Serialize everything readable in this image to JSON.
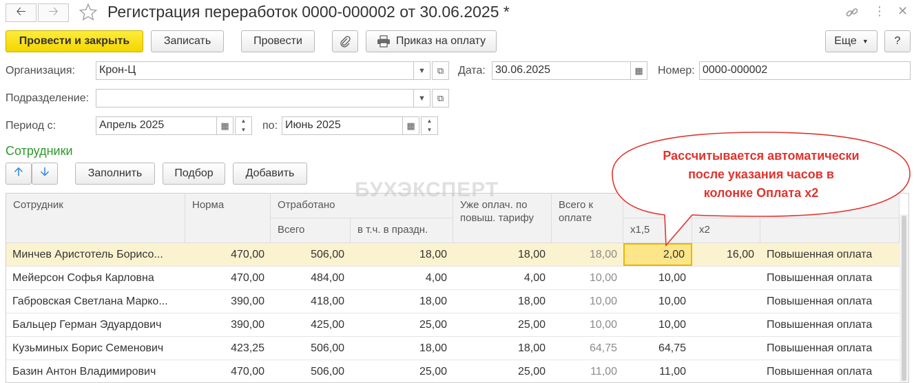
{
  "window": {
    "title": "Регистрация переработок 0000-000002 от 30.06.2025 *",
    "icons": [
      "back-arrow-icon",
      "forward-arrow-icon",
      "star-icon",
      "link-icon",
      "more-vertical-icon",
      "close-icon"
    ]
  },
  "toolbar": {
    "post_close": "Провести и закрыть",
    "save": "Записать",
    "post": "Провести",
    "print_order": "Приказ на оплату",
    "more": "Еще",
    "help": "?"
  },
  "form": {
    "org_label": "Организация:",
    "org_value": "Крон-Ц",
    "date_label": "Дата:",
    "date_value": "30.06.2025",
    "number_label": "Номер:",
    "number_value": "0000-000002",
    "dept_label": "Подразделение:",
    "dept_value": "",
    "period_from_label": "Период с:",
    "period_from_value": "Апрель 2025",
    "period_to_label": "по:",
    "period_to_value": "Июнь 2025"
  },
  "employees": {
    "section_title": "Сотрудники",
    "fill": "Заполнить",
    "pick": "Подбор",
    "add": "Добавить"
  },
  "watermark": "БУХЭКСПЕРТ",
  "callout": {
    "line1": "Рассчитывается автоматически",
    "line2": "после указания часов в",
    "line3": "колонке Оплата х2"
  },
  "table": {
    "headers": {
      "employee": "Сотрудник",
      "norm": "Норма",
      "worked": "Отработано",
      "worked_total": "Всего",
      "worked_holiday": "в т.ч. в праздн.",
      "already_paid": "Уже оплач. по повыш. тарифу",
      "total_to_pay": "Всего к оплате",
      "x15": "х1,5",
      "x2": "х2",
      "type": ""
    },
    "rows": [
      {
        "name": "Минчев Аристотель Борисо...",
        "norm": "470,00",
        "total": "506,00",
        "holiday": "18,00",
        "paid": "18,00",
        "to_pay": "18,00",
        "x15": "2,00",
        "x2": "16,00",
        "type": "Повышенная оплата"
      },
      {
        "name": "Мейерсон Софья Карловна",
        "norm": "470,00",
        "total": "484,00",
        "holiday": "4,00",
        "paid": "4,00",
        "to_pay": "10,00",
        "x15": "10,00",
        "x2": "",
        "type": "Повышенная оплата"
      },
      {
        "name": "Габровская Светлана Марко...",
        "norm": "390,00",
        "total": "418,00",
        "holiday": "18,00",
        "paid": "18,00",
        "to_pay": "10,00",
        "x15": "10,00",
        "x2": "",
        "type": "Повышенная оплата"
      },
      {
        "name": "Бальцер Герман Эдуардович",
        "norm": "390,00",
        "total": "425,00",
        "holiday": "25,00",
        "paid": "25,00",
        "to_pay": "10,00",
        "x15": "10,00",
        "x2": "",
        "type": "Повышенная оплата"
      },
      {
        "name": "Кузьминых Борис Семенович",
        "norm": "423,25",
        "total": "506,00",
        "holiday": "18,00",
        "paid": "18,00",
        "to_pay": "64,75",
        "x15": "64,75",
        "x2": "",
        "type": "Повышенная оплата"
      },
      {
        "name": "Базин Антон Владимирович",
        "norm": "470,00",
        "total": "506,00",
        "holiday": "25,00",
        "paid": "25,00",
        "to_pay": "11,00",
        "x15": "11,00",
        "x2": "",
        "type": "Повышенная оплата"
      }
    ]
  }
}
